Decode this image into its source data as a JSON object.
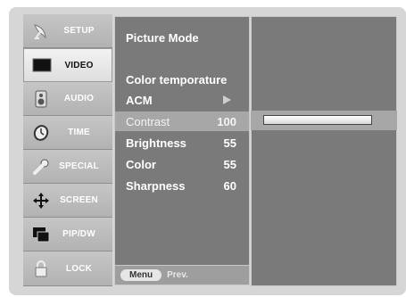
{
  "menu": [
    {
      "label": "SETUP",
      "icon": "satellite-dish-icon",
      "active": false
    },
    {
      "label": "VIDEO",
      "icon": "tv-screen-icon",
      "active": true
    },
    {
      "label": "AUDIO",
      "icon": "speaker-icon",
      "active": false
    },
    {
      "label": "TIME",
      "icon": "clock-icon",
      "active": false
    },
    {
      "label": "SPECIAL",
      "icon": "wrench-icon",
      "active": false
    },
    {
      "label": "SCREEN",
      "icon": "arrows-icon",
      "active": false
    },
    {
      "label": "PIP/DW",
      "icon": "pip-windows-icon",
      "active": false
    },
    {
      "label": "LOCK",
      "icon": "padlock-icon",
      "active": false
    }
  ],
  "video_menu": {
    "picture_mode": "Picture Mode",
    "color_temperature": "Color temporature",
    "acm": "ACM",
    "contrast": {
      "label": "Contrast",
      "value": "100"
    },
    "brightness": {
      "label": "Brightness",
      "value": "55"
    },
    "color": {
      "label": "Color",
      "value": "55"
    },
    "sharpness": {
      "label": "Sharpness",
      "value": "60"
    }
  },
  "footer": {
    "menu_button": "Menu",
    "prev_label": "Prev."
  },
  "slider": {
    "contrast_level_fraction": 1.0
  },
  "colors": {
    "panel": "#7a7a7a",
    "highlight": "#a7a7a7",
    "frame": "#d6d6d6"
  }
}
